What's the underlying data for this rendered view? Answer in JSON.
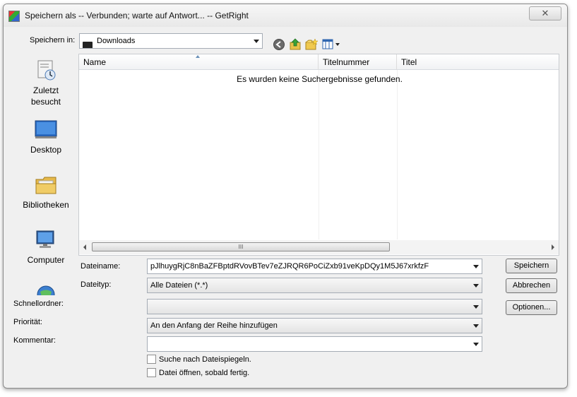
{
  "window": {
    "title": "Speichern als -- Verbunden; warte auf Antwort... -- GetRight",
    "close_glyph": "✕"
  },
  "toolbar": {
    "save_in_label": "Speichern in:",
    "location": "Downloads"
  },
  "places": [
    {
      "label_line1": "Zuletzt",
      "label_line2": "besucht",
      "icon": "recent-places-icon"
    },
    {
      "label_line1": "Desktop",
      "label_line2": "",
      "icon": "desktop-icon"
    },
    {
      "label_line1": "Bibliotheken",
      "label_line2": "",
      "icon": "libraries-icon"
    },
    {
      "label_line1": "Computer",
      "label_line2": "",
      "icon": "computer-icon"
    },
    {
      "label_line1": "",
      "label_line2": "",
      "icon": "network-icon"
    }
  ],
  "file_list": {
    "columns": [
      "Name",
      "Titelnummer",
      "Titel"
    ],
    "empty_message": "Es wurden keine Suchergebnisse gefunden.",
    "scroll_grip": "III"
  },
  "form": {
    "filename_label": "Dateiname:",
    "filename_value": "pJlhuygRjC8nBaZFBptdRVovBTev7eZJRQR6PoCiZxb91veKpDQy1M5J67xrkfzF",
    "filetype_label": "Dateityp:",
    "filetype_value": "Alle Dateien (*.*)",
    "quickfolder_label": "Schnellordner:",
    "quickfolder_value": "",
    "priority_label": "Priorität:",
    "priority_value": "An den Anfang der Reihe hinzufügen",
    "comment_label": "Kommentar:",
    "comment_value": ""
  },
  "buttons": {
    "save": "Speichern",
    "cancel": "Abbrechen",
    "options": "Optionen..."
  },
  "checkboxes": {
    "search_mirrors": "Suche nach Dateispiegeln.",
    "open_when_done": "Datei öffnen, sobald fertig."
  }
}
